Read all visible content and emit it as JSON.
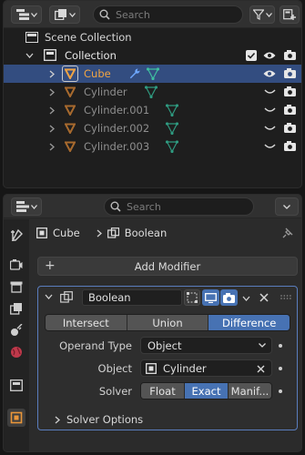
{
  "outliner": {
    "search_placeholder": "Search",
    "rows": [
      {
        "label": "Scene Collection"
      },
      {
        "label": "Collection"
      },
      {
        "label": "Cube"
      },
      {
        "label": "Cylinder"
      },
      {
        "label": "Cylinder.001"
      },
      {
        "label": "Cylinder.002"
      },
      {
        "label": "Cylinder.003"
      }
    ]
  },
  "properties": {
    "search_placeholder": "Search",
    "breadcrumb": {
      "object": "Cube",
      "modifier": "Boolean"
    },
    "add_modifier": "Add Modifier",
    "modifier": {
      "name": "Boolean",
      "operations": [
        "Intersect",
        "Union",
        "Difference"
      ],
      "selected_operation": "Difference",
      "operand_type_label": "Operand Type",
      "operand_type_value": "Object",
      "object_label": "Object",
      "object_value": "Cylinder",
      "solver_label": "Solver",
      "solvers": [
        "Float",
        "Exact",
        "Manif..."
      ],
      "selected_solver": "Exact",
      "solver_options": "Solver Options"
    }
  },
  "colors": {
    "selection_blue": "#4772b3",
    "object_orange": "#e9963a",
    "mesh_green": "#3fbf9f",
    "active_row": "#334d80"
  }
}
